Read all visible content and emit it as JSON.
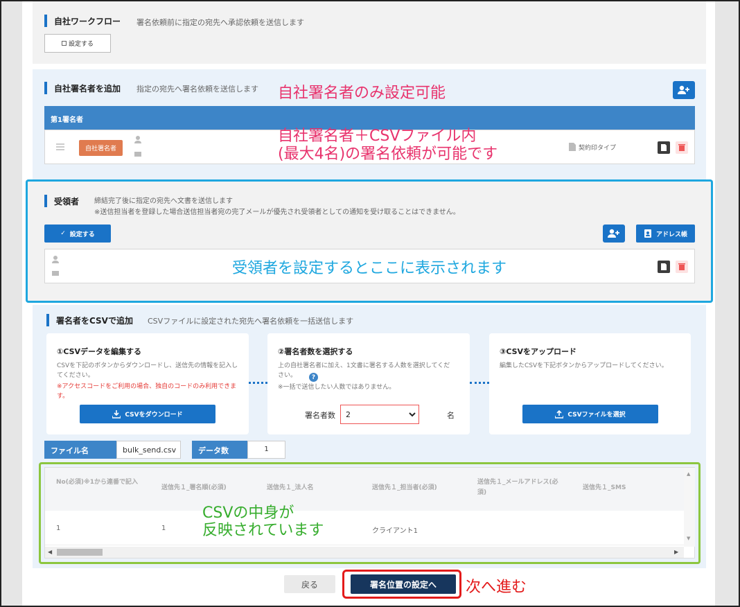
{
  "workflow": {
    "title": "自社ワークフロー",
    "desc": "署名依頼前に指定の宛先へ承認依頼を送信します",
    "setting_button": "設定する",
    "setting_icon": "checkbox-icon"
  },
  "signer_section": {
    "title": "自社署名者を追加",
    "desc": "指定の宛先へ署名依頼を送信します",
    "header": "第1署名者",
    "badge": "自社署名者",
    "seal_type": "契約印タイプ",
    "add_icon": "person-add-icon"
  },
  "receiver_section": {
    "title": "受領者",
    "desc_line1": "締結完了後に指定の宛先へ文書を送信します",
    "desc_line2": "※送信担当者を登録した場合送信担当者宛の完了メールが優先され受領者としての通知を受け取ることはできません。",
    "setting_button": "設定する",
    "address_book_button": "アドレス帳"
  },
  "csv_section": {
    "title": "署名者をCSVで追加",
    "desc": "CSVファイルに設定された宛先へ署名依頼を一括送信します",
    "step1": {
      "title": "①CSVデータを編集する",
      "desc": "CSVを下記のボタンからダウンロードし、送信先の情報を記入してください。",
      "note": "※アクセスコードをご利用の場合、独自のコードのみ利用できます。",
      "button": "CSVをダウンロード"
    },
    "step2": {
      "title": "②署名者数を選択する",
      "desc": "上の自社署名者に加え、1文書に署名する人数を選択してください。",
      "note": "※一括で送信したい人数ではありません。",
      "select_label": "署名者数",
      "select_value": "2",
      "select_unit": "名"
    },
    "step3": {
      "title": "③CSVをアップロード",
      "desc": "編集したCSVを下記ボタンからアップロードしてください。",
      "button": "CSVファイルを選択"
    },
    "file_label": "ファイル名",
    "file_value": "bulk_send.csv",
    "count_label": "データ数",
    "count_value": "1",
    "table": {
      "headers": [
        "No(必須)※1から連番で記入",
        "送信先１_署名順(必須)",
        "送信先１_法人名",
        "送信先１_担当者(必須)",
        "送信先１_メールアドレス(必須)",
        "送信先１_SMS"
      ],
      "rows": [
        [
          "1",
          "1",
          "",
          "クライアント1",
          "",
          ""
        ]
      ]
    }
  },
  "footer": {
    "back_button": "戻る",
    "next_button": "署名位置の設定へ"
  },
  "annotations": {
    "signer_only": "自社署名者のみ設定可能",
    "csv_line1": "自社署名者＋CSVファイル内",
    "csv_line2": "(最大4名)の署名依頼が可能です",
    "receiver_display": "受領者を設定するとここに表示されます",
    "csv_content_line1": "CSVの中身が",
    "csv_content_line2": "反映されています",
    "next_step": "次へ進む"
  },
  "colors": {
    "accent": "#1a73c7",
    "annot_pink": "#e8336d",
    "annot_cyan": "#1ea7df",
    "annot_green": "#36ad2d",
    "annot_red": "#e31b1b",
    "badge": "#e07b4f"
  }
}
